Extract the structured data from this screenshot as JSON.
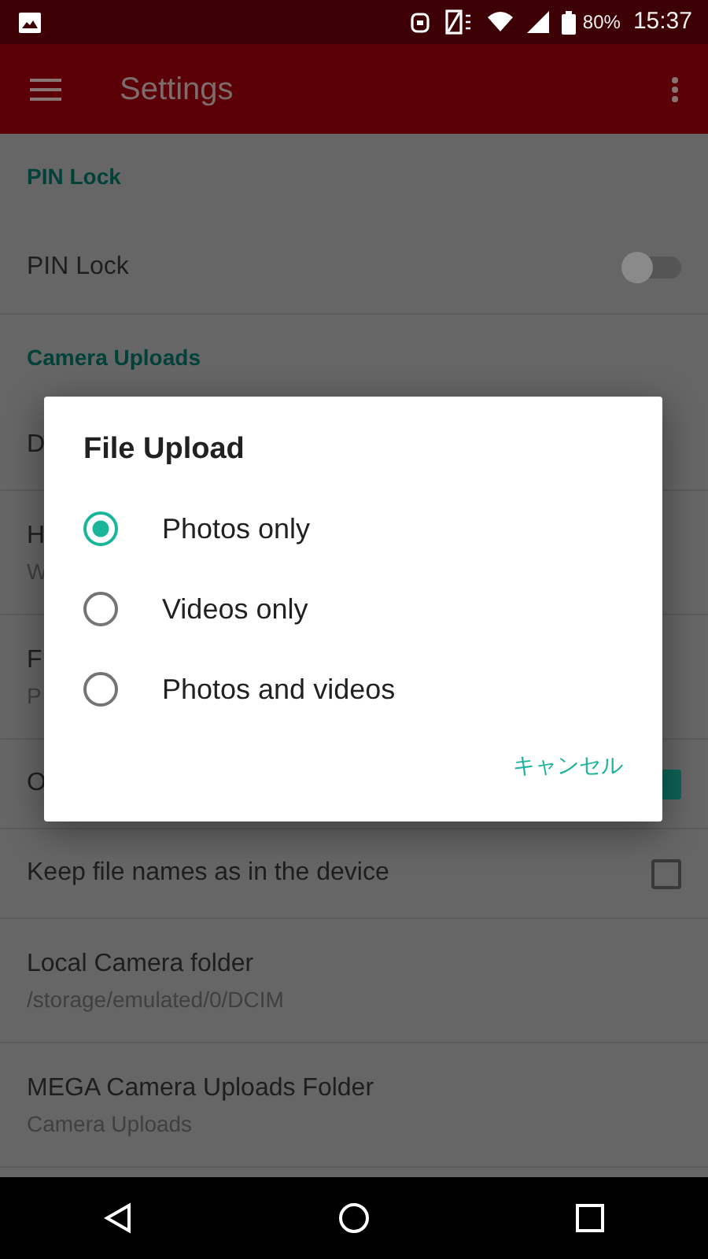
{
  "status_bar": {
    "battery": "80%",
    "time": "15:37"
  },
  "app_bar": {
    "title": "Settings"
  },
  "settings": [
    {
      "kind": "header",
      "title": "PIN Lock"
    },
    {
      "kind": "switch",
      "title": "PIN Lock",
      "on": false
    },
    {
      "kind": "header",
      "title": "Camera Uploads"
    },
    {
      "kind": "item",
      "title": "D"
    },
    {
      "kind": "item",
      "title": "H",
      "subtitle": "W"
    },
    {
      "kind": "item",
      "title": "F",
      "subtitle": "P"
    },
    {
      "kind": "checkbox",
      "title": "O",
      "checked": true
    },
    {
      "kind": "checkbox",
      "title": "Keep file names as in the device",
      "checked": false
    },
    {
      "kind": "item",
      "title": "Local Camera folder",
      "subtitle": "/storage/emulated/0/DCIM"
    },
    {
      "kind": "item",
      "title": "MEGA Camera Uploads Folder",
      "subtitle": "Camera Uploads"
    }
  ],
  "dialog": {
    "title": "File Upload",
    "options": [
      {
        "label": "Photos only",
        "selected": true
      },
      {
        "label": "Videos only",
        "selected": false
      },
      {
        "label": "Photos and videos",
        "selected": false
      }
    ],
    "cancel": "キャンセル"
  }
}
